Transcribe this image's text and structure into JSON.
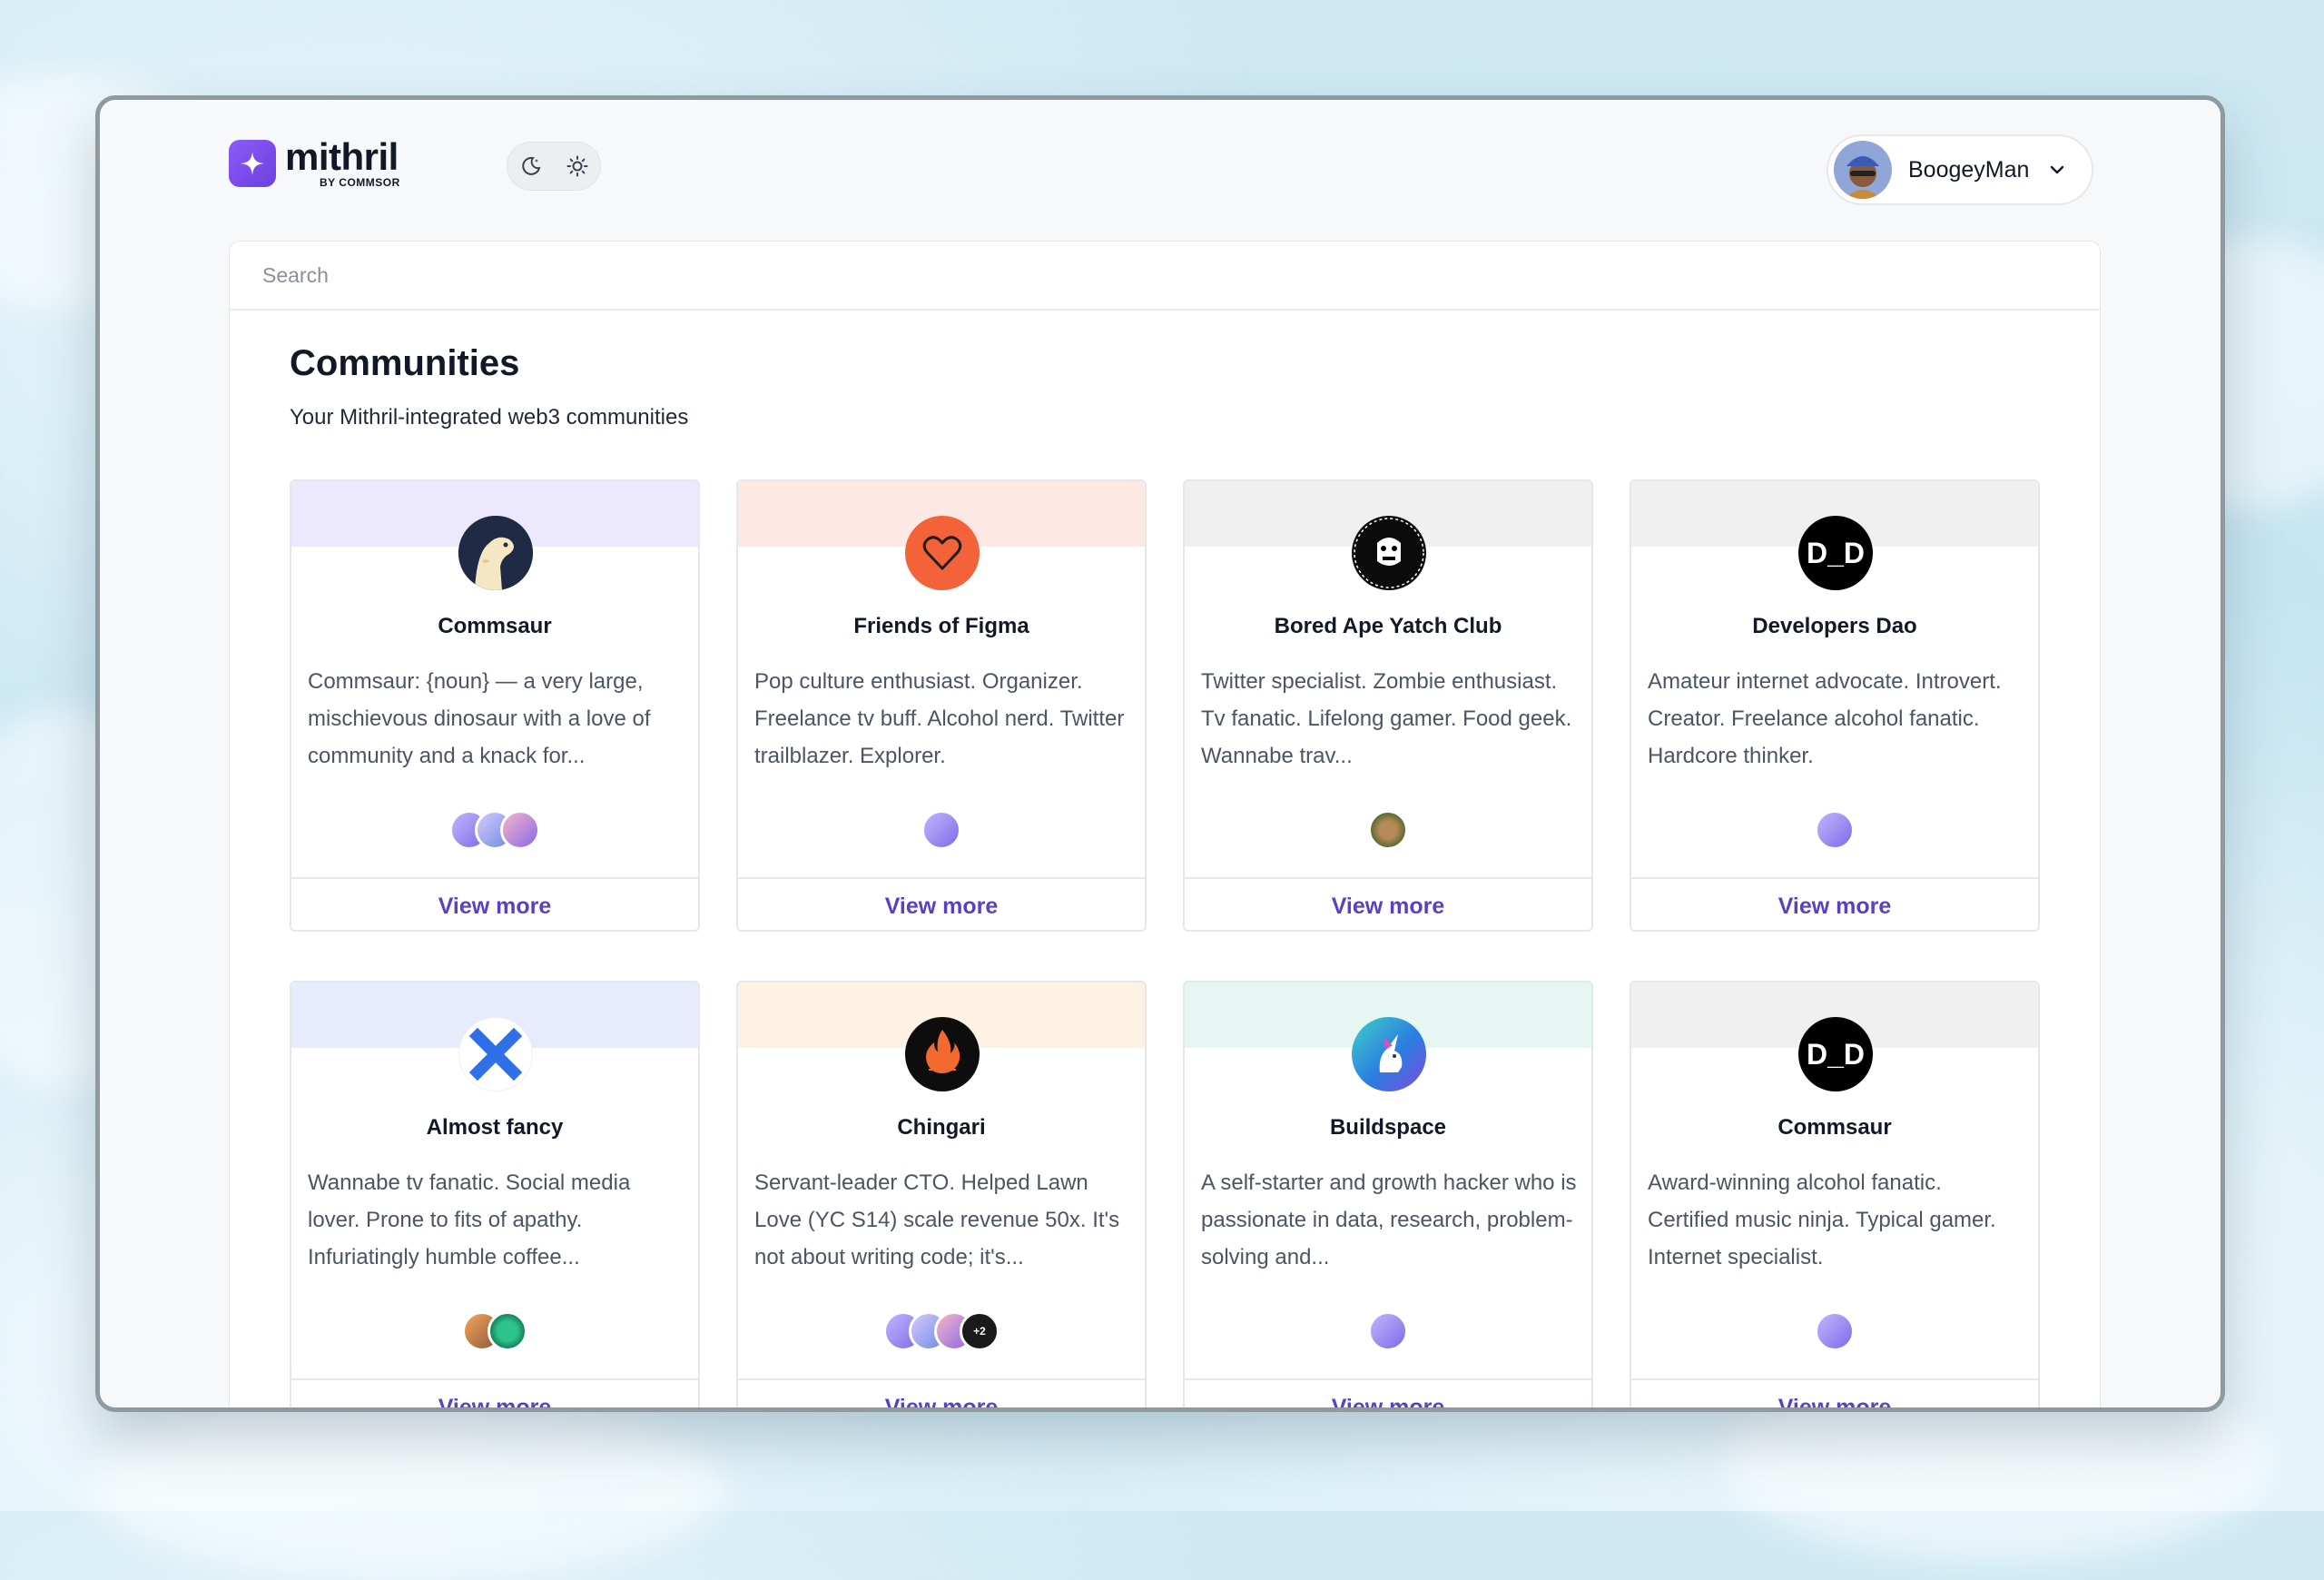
{
  "app": {
    "name": "mithril",
    "by": "BY COMMSOR"
  },
  "user": {
    "name": "BoogeyMan"
  },
  "search": {
    "placeholder": "Search"
  },
  "page": {
    "title": "Communities",
    "subtitle": "Your Mithril-integrated web3 communities"
  },
  "communities": [
    {
      "name": "Commsaur",
      "description": "Commsaur: {noun} — a very large, mischievous dinosaur with a love of community and a knack for...",
      "band_color": "#ece8fd",
      "logo_icon": "dinosaur-icon",
      "members": 3,
      "action": "View more"
    },
    {
      "name": "Friends of Figma",
      "description": "Pop culture enthusiast. Organizer. Freelance tv buff. Alcohol nerd. Twitter trailblazer. Explorer.",
      "band_color": "#fde8e4",
      "logo_icon": "heart-icon",
      "members": 1,
      "action": "View more"
    },
    {
      "name": "Bored Ape Yatch Club",
      "description": "Twitter specialist. Zombie enthusiast. Tv fanatic. Lifelong gamer. Food geek. Wannabe trav...",
      "band_color": "#f0f0f1",
      "logo_icon": "ape-icon",
      "members": 1,
      "action": "View more"
    },
    {
      "name": "Developers Dao",
      "description": "Amateur internet advocate. Introvert. Creator. Freelance alcohol fanatic. Hardcore thinker.",
      "band_color": "#f0f0f1",
      "logo_icon": "dd-icon",
      "members": 1,
      "action": "View more"
    },
    {
      "name": "Almost fancy",
      "description": "Wannabe tv fanatic. Social media lover. Prone to fits of apathy. Infuriatingly humble coffee...",
      "band_color": "#e7ecfd",
      "logo_icon": "x-icon",
      "members": 2,
      "action": "View more"
    },
    {
      "name": "Chingari",
      "description": "Servant-leader CTO. Helped Lawn Love (YC S14) scale revenue 50x. It's not about writing code; it's...",
      "band_color": "#fdf2e4",
      "logo_icon": "flame-icon",
      "members": 3,
      "extra_members": "+2",
      "action": "View more"
    },
    {
      "name": "Buildspace",
      "description": "A self-starter and growth hacker who is passionate in data, research, problem-solving and...",
      "band_color": "#e6f6f2",
      "logo_icon": "unicorn-icon",
      "members": 1,
      "action": "View more"
    },
    {
      "name": "Commsaur",
      "description": "Award-winning alcohol fanatic. Certified music ninja. Typical gamer. Internet specialist.",
      "band_color": "#f0f0f1",
      "logo_icon": "dd-icon",
      "members": 1,
      "action": "View more"
    }
  ]
}
